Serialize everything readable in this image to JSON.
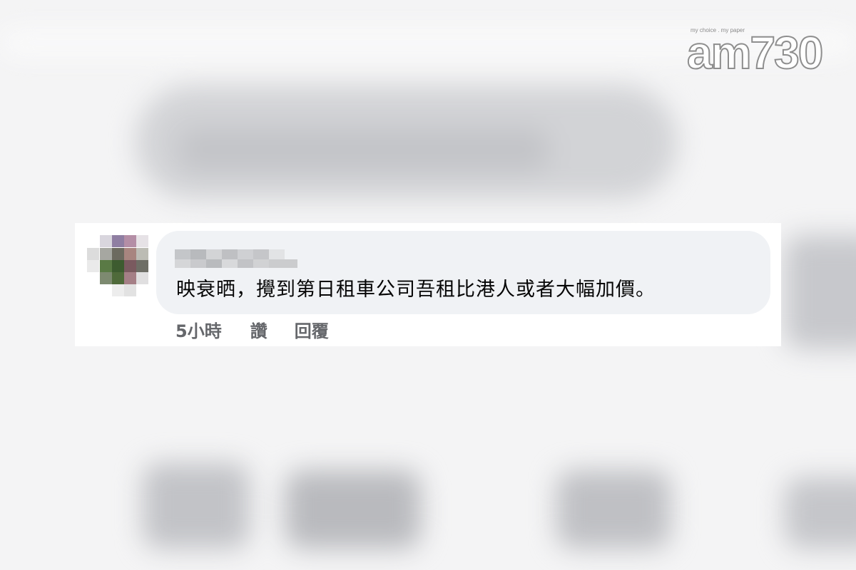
{
  "logo": {
    "tagline": "my choice . my paper",
    "brand": "am730"
  },
  "comment": {
    "author_avatar_icon": "pixelated-avatar-icon",
    "author_name_icon": "pixelated-name-icon",
    "text": "映衰晒，攪到第日租車公司吾租比港人或者大幅加價。",
    "actions": {
      "time": "5小時",
      "like": "讚",
      "reply": "回覆"
    }
  },
  "colors": {
    "bubble_bg": "#f0f2f5",
    "text": "#050505",
    "action_text": "#65676b",
    "page_bg": "#f4f4f5"
  }
}
